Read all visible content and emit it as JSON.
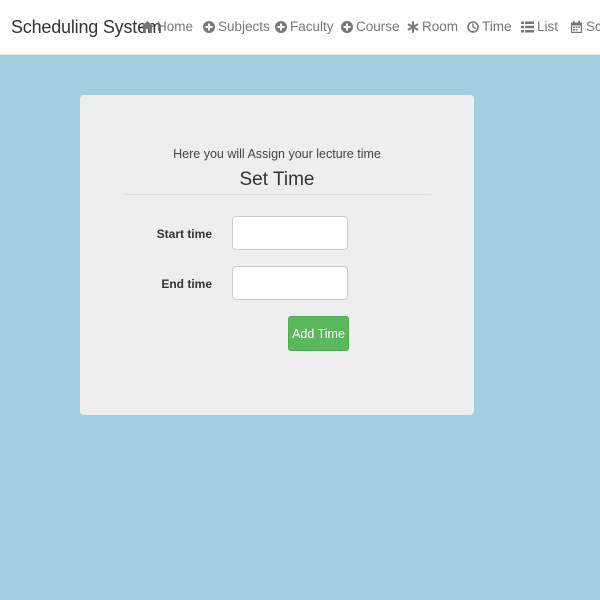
{
  "navbar": {
    "brand": "Scheduling System",
    "items": [
      {
        "label": "Home",
        "icon": "home-icon"
      },
      {
        "label": "Subjects",
        "icon": "plus-circle-icon"
      },
      {
        "label": "Faculty",
        "icon": "plus-circle-icon"
      },
      {
        "label": "Course",
        "icon": "plus-circle-icon"
      },
      {
        "label": "Room",
        "icon": "asterisk-icon"
      },
      {
        "label": "Time",
        "icon": "clock-icon"
      },
      {
        "label": "List",
        "icon": "list-icon"
      },
      {
        "label": "Sch",
        "icon": "calendar-icon"
      }
    ]
  },
  "form": {
    "subtitle": "Here you will Assign your lecture time",
    "title": "Set Time",
    "start_label": "Start time",
    "start_value": "",
    "end_label": "End time",
    "end_value": "",
    "submit_label": "Add Time"
  },
  "colors": {
    "background": "#a2cfe0",
    "card": "#eeeeee",
    "button": "#5cb85c",
    "nav_text": "#777777"
  }
}
